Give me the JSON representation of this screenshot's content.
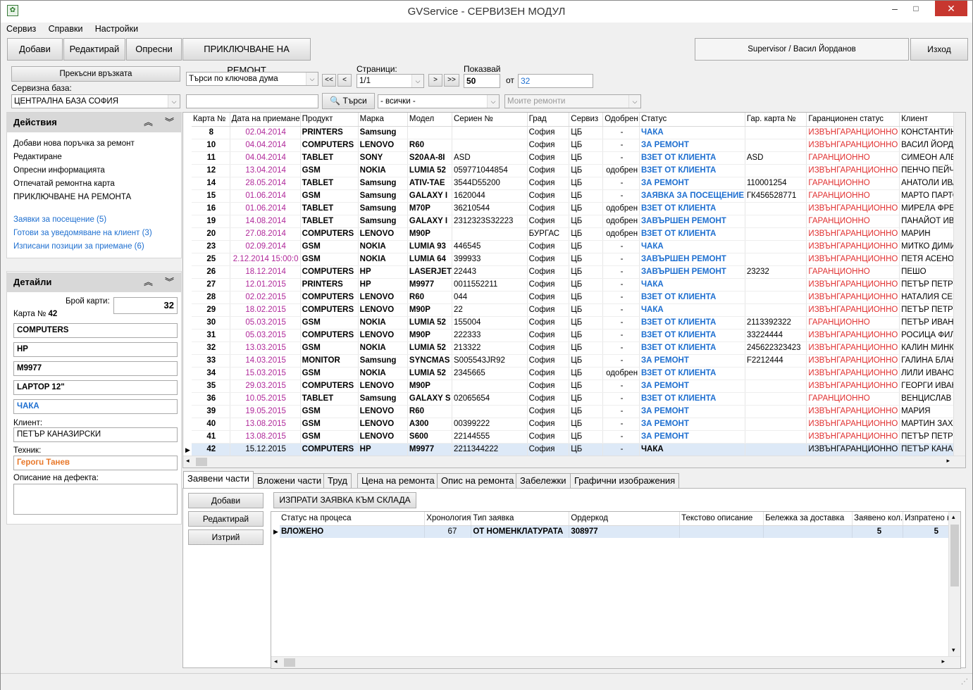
{
  "window": {
    "title": "GVService - СЕРВИЗЕН МОДУЛ",
    "icon": "app-logo-icon",
    "min": "‒",
    "max": "□",
    "close": "✕"
  },
  "menu": [
    "Сервиз",
    "Справки",
    "Настройки"
  ],
  "toolbar": {
    "add": "Добави",
    "edit": "Редактирай",
    "refresh": "Опресни",
    "finish": "ПРИКЛЮЧВАНЕ НА РЕМОНТ",
    "user": "Supervisor / Васил Йорданов",
    "exit": "Изход"
  },
  "filters": {
    "disconnect": "Прекъсни връзката",
    "base_label": "Сервизна база:",
    "base_value": "ЦЕНТРАЛНА БАЗА СОФИЯ",
    "search_mode": "Търси по ключова дума",
    "search_value": "",
    "search_btn": "Търси",
    "pages_label": "Страници:",
    "pages_value": "1/1",
    "first": "<<",
    "prev": "<",
    "next": ">",
    "last": ">>",
    "show_label": "Показвай",
    "show_value": "50",
    "of_label": "от",
    "total": "32",
    "all": "- всички -",
    "my_repairs": "Моите ремонти"
  },
  "actions": {
    "title": "Действия",
    "items": [
      "Добави нова поръчка за ремонт",
      "Редактиране",
      "Опресни информацията",
      "Отпечатай ремонтна карта",
      "ПРИКЛЮЧВАНЕ НА РЕМОНТА"
    ],
    "links": [
      "Заявки за посещение (5)",
      "Готови за уведомяване на клиент (3)",
      "Изписани позиции за приемане (6)"
    ]
  },
  "details": {
    "title": "Детайли",
    "count_label": "Брой карти:",
    "count": "32",
    "card_label": "Карта №",
    "card_no": "42",
    "product": "COMPUTERS",
    "brand": "HP",
    "model": "M9977",
    "desc": "LAPTOP 12\"",
    "status": "ЧАКА",
    "client_label": "Клиент:",
    "client": "ПЕТЪР КАНАЗИРСКИ",
    "tech_label": "Техник:",
    "tech": "Герогu Танев",
    "defect_label": "Описание на дефекта:",
    "defect": ""
  },
  "grid": {
    "columns": [
      "Карта №",
      "Дата на приемане",
      "Продукт",
      "Марка",
      "Модел",
      "Сериен №",
      "Град",
      "Сервиз",
      "Одобрен",
      "Статус",
      "Гар. карта №",
      "Гаранционен статус",
      "Клиент"
    ],
    "rows": [
      [
        "8",
        "02.04.2014",
        "PRINTERS",
        "Samsung",
        "",
        "",
        "София",
        "ЦБ",
        "-",
        "ЧАКА",
        "",
        "ИЗВЪНГАРАНЦИОННО",
        "КОНСТАНТИН"
      ],
      [
        "10",
        "04.04.2014",
        "COMPUTERS",
        "LENOVO",
        "R60",
        "",
        "София",
        "ЦБ",
        "-",
        "ЗА РЕМОНТ",
        "",
        "ИЗВЪНГАРАНЦИОННО",
        "ВАСИЛ ЙОРДА"
      ],
      [
        "11",
        "04.04.2014",
        "TABLET",
        "SONY",
        "S20AA-8I",
        "ASD",
        "София",
        "ЦБ",
        "-",
        "ВЗЕТ ОТ КЛИЕНТА",
        "ASD",
        "ГАРАНЦИОННО",
        "СИМЕОН АЛЕК"
      ],
      [
        "12",
        "13.04.2014",
        "GSM",
        "NOKIA",
        "LUMIA 52",
        "059771044854",
        "София",
        "ЦБ",
        "одобрен",
        "ВЗЕТ ОТ КЛИЕНТА",
        "",
        "ИЗВЪНГАРАНЦИОННО",
        "ПЕНЧО ПЕЙЧЕ"
      ],
      [
        "14",
        "28.05.2014",
        "TABLET",
        "Samsung",
        "ATIV-TAE",
        "3544D55200",
        "София",
        "ЦБ",
        "-",
        "ЗА РЕМОНТ",
        "110001254",
        "ГАРАНЦИОННО",
        "АНАТОЛИ ИВА"
      ],
      [
        "15",
        "01.06.2014",
        "GSM",
        "Samsung",
        "GALAXY I",
        "1620044",
        "София",
        "ЦБ",
        "-",
        "ЗАЯВКА ЗА ПОСЕЩЕНИЕ",
        "ГК456528771",
        "ГАРАНЦИОННО",
        "МАРТО ПАРТО"
      ],
      [
        "16",
        "01.06.2014",
        "TABLET",
        "Samsung",
        "M70P",
        "36210544",
        "София",
        "ЦБ",
        "одобрен",
        "ВЗЕТ ОТ КЛИЕНТА",
        "",
        "ИЗВЪНГАРАНЦИОННО",
        "МИРЕЛА ФРЕН"
      ],
      [
        "19",
        "14.08.2014",
        "TABLET",
        "Samsung",
        "GALAXY I",
        "2312323S32223",
        "София",
        "ЦБ",
        "одобрен",
        "ЗАВЪРШЕН РЕМОНТ",
        "",
        "ГАРАНЦИОННО",
        "ПАНАЙОТ ИВА"
      ],
      [
        "20",
        "27.08.2014",
        "COMPUTERS",
        "LENOVO",
        "M90P",
        "",
        "БУРГАС",
        "ЦБ",
        "одобрен",
        "ВЗЕТ ОТ КЛИЕНТА",
        "",
        "ИЗВЪНГАРАНЦИОННО",
        "МАРИН"
      ],
      [
        "23",
        "02.09.2014",
        "GSM",
        "NOKIA",
        "LUMIA 93",
        "446545",
        "София",
        "ЦБ",
        "-",
        "ЧАКА",
        "",
        "ИЗВЪНГАРАНЦИОННО",
        "МИТКО ДИМИТ"
      ],
      [
        "25",
        "2.12.2014 15:00:0",
        "GSM",
        "NOKIA",
        "LUMIA 64",
        "399933",
        "София",
        "ЦБ",
        "-",
        "ЗАВЪРШЕН РЕМОНТ",
        "",
        "ИЗВЪНГАРАНЦИОННО",
        "ПЕТЯ АСЕНОВА"
      ],
      [
        "26",
        "18.12.2014",
        "COMPUTERS",
        "HP",
        "LASERJET",
        "22443",
        "София",
        "ЦБ",
        "-",
        "ЗАВЪРШЕН РЕМОНТ",
        "23232",
        "ГАРАНЦИОННО",
        "ПЕШО"
      ],
      [
        "27",
        "12.01.2015",
        "PRINTERS",
        "HP",
        "M9977",
        "0011552211",
        "София",
        "ЦБ",
        "-",
        "ЧАКА",
        "",
        "ИЗВЪНГАРАНЦИОННО",
        "ПЕТЪР ПЕТРУН"
      ],
      [
        "28",
        "02.02.2015",
        "COMPUTERS",
        "LENOVO",
        "R60",
        "044",
        "София",
        "ЦБ",
        "-",
        "ВЗЕТ ОТ КЛИЕНТА",
        "",
        "ИЗВЪНГАРАНЦИОННО",
        "НАТАЛИЯ СЕИ"
      ],
      [
        "29",
        "18.02.2015",
        "COMPUTERS",
        "LENOVO",
        "M90P",
        "22",
        "София",
        "ЦБ",
        "-",
        "ЧАКА",
        "",
        "ИЗВЪНГАРАНЦИОННО",
        "ПЕТЪР ПЕТРУН"
      ],
      [
        "30",
        "05.03.2015",
        "GSM",
        "NOKIA",
        "LUMIA 52",
        "155004",
        "София",
        "ЦБ",
        "-",
        "ВЗЕТ ОТ КЛИЕНТА",
        "2113392322",
        "ГАРАНЦИОННО",
        "ПЕТЪР ИВАНО"
      ],
      [
        "31",
        "05.03.2015",
        "COMPUTERS",
        "LENOVO",
        "M90P",
        "222333",
        "София",
        "ЦБ",
        "-",
        "ВЗЕТ ОТ КЛИЕНТА",
        "33224444",
        "ИЗВЪНГАРАНЦИОННО",
        "РОСИЦА ФИЛИ"
      ],
      [
        "32",
        "13.03.2015",
        "GSM",
        "NOKIA",
        "LUMIA 52",
        "213322",
        "София",
        "ЦБ",
        "-",
        "ВЗЕТ ОТ КЛИЕНТА",
        "245622323423",
        "ИЗВЪНГАРАНЦИОННО",
        "КАЛИН МИНКИ"
      ],
      [
        "33",
        "14.03.2015",
        "MONITOR",
        "Samsung",
        "SYNCMAS",
        "S005543JR92",
        "София",
        "ЦБ",
        "-",
        "ЗА РЕМОНТ",
        "F2212444",
        "ИЗВЪНГАРАНЦИОННО",
        "ГАЛИНА БЛАН"
      ],
      [
        "34",
        "15.03.2015",
        "GSM",
        "NOKIA",
        "LUMIA 52",
        "2345665",
        "София",
        "ЦБ",
        "одобрен",
        "ВЗЕТ ОТ КЛИЕНТА",
        "",
        "ИЗВЪНГАРАНЦИОННО",
        "ЛИЛИ ИВАНОВ"
      ],
      [
        "35",
        "29.03.2015",
        "COMPUTERS",
        "LENOVO",
        "M90P",
        "",
        "София",
        "ЦБ",
        "-",
        "ЗА РЕМОНТ",
        "",
        "ИЗВЪНГАРАНЦИОННО",
        "ГЕОРГИ ИВАНО"
      ],
      [
        "36",
        "10.05.2015",
        "TABLET",
        "Samsung",
        "GALAXY S",
        "02065654",
        "София",
        "ЦБ",
        "-",
        "ВЗЕТ ОТ КЛИЕНТА",
        "",
        "ГАРАНЦИОННО",
        "ВЕНЦИСЛАВ С"
      ],
      [
        "39",
        "19.05.2015",
        "GSM",
        "LENOVO",
        "R60",
        "",
        "София",
        "ЦБ",
        "-",
        "ЗА РЕМОНТ",
        "",
        "ИЗВЪНГАРАНЦИОННО",
        "МАРИЯ"
      ],
      [
        "40",
        "13.08.2015",
        "GSM",
        "LENOVO",
        "A300",
        "00399222",
        "София",
        "ЦБ",
        "-",
        "ЗА РЕМОНТ",
        "",
        "ИЗВЪНГАРАНЦИОННО",
        "МАРТИН ЗАХАI"
      ],
      [
        "41",
        "13.08.2015",
        "GSM",
        "LENOVO",
        "S600",
        "22144555",
        "София",
        "ЦБ",
        "-",
        "ЗА РЕМОНТ",
        "",
        "ИЗВЪНГАРАНЦИОННО",
        "ПЕТЪР ПЕТРУН"
      ],
      [
        "42",
        "15.12.2015",
        "COMPUTERS",
        "HP",
        "M9977",
        "2211344222",
        "София",
        "ЦБ",
        "-",
        "ЧАКА",
        "",
        "ИЗВЪНГАРАНЦИОННО",
        "ПЕТЪР КАНАЗI"
      ]
    ],
    "selected_index": 25,
    "status_color": "#1e6fd0",
    "warranty_color": "#e03030",
    "date_color": "#b0289a",
    "selection_color": "#dde9f7"
  },
  "tabs": [
    "Заявени части",
    "Вложени части",
    "Труд",
    "Цена на ремонта",
    "Опис на ремонта",
    "Забележки",
    "Графични изображения"
  ],
  "parts": {
    "add": "Добави",
    "edit": "Редактирай",
    "delete": "Изтрий",
    "send": "ИЗПРАТИ ЗАЯВКА КЪМ СКЛАДА",
    "columns": [
      "Статус на процеса",
      "Хронология",
      "Тип заявка",
      "Ордеркод",
      "Текстово описание",
      "Бележка за доставка",
      "Заявено кол.",
      "Изпратено кол"
    ],
    "rows": [
      [
        "ВЛОЖЕНО",
        "67",
        "ОТ НОМЕНКЛАТУРАТА",
        "308977",
        "",
        "",
        "5",
        "5"
      ]
    ]
  }
}
